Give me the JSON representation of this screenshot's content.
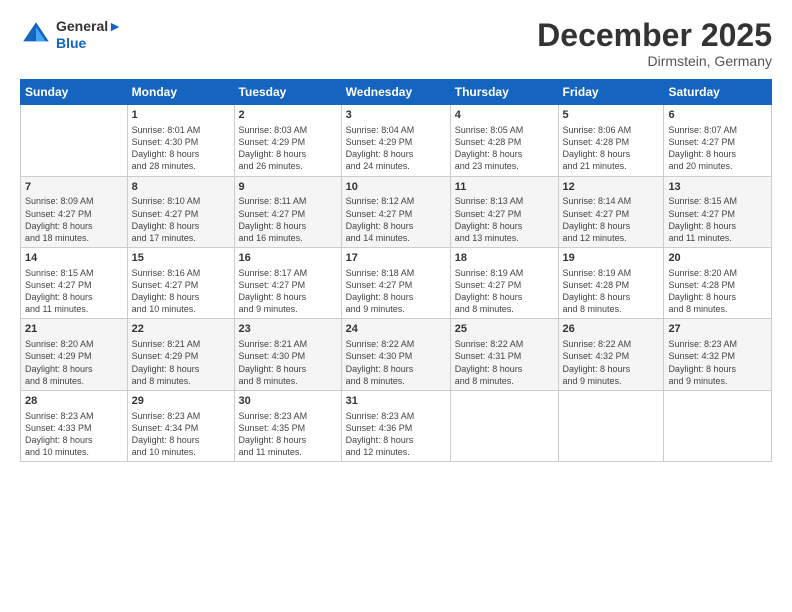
{
  "header": {
    "logo_line1": "General",
    "logo_line2": "Blue",
    "month": "December 2025",
    "location": "Dirmstein, Germany"
  },
  "weekdays": [
    "Sunday",
    "Monday",
    "Tuesday",
    "Wednesday",
    "Thursday",
    "Friday",
    "Saturday"
  ],
  "weeks": [
    [
      {
        "day": "",
        "text": ""
      },
      {
        "day": "1",
        "text": "Sunrise: 8:01 AM\nSunset: 4:30 PM\nDaylight: 8 hours\nand 28 minutes."
      },
      {
        "day": "2",
        "text": "Sunrise: 8:03 AM\nSunset: 4:29 PM\nDaylight: 8 hours\nand 26 minutes."
      },
      {
        "day": "3",
        "text": "Sunrise: 8:04 AM\nSunset: 4:29 PM\nDaylight: 8 hours\nand 24 minutes."
      },
      {
        "day": "4",
        "text": "Sunrise: 8:05 AM\nSunset: 4:28 PM\nDaylight: 8 hours\nand 23 minutes."
      },
      {
        "day": "5",
        "text": "Sunrise: 8:06 AM\nSunset: 4:28 PM\nDaylight: 8 hours\nand 21 minutes."
      },
      {
        "day": "6",
        "text": "Sunrise: 8:07 AM\nSunset: 4:27 PM\nDaylight: 8 hours\nand 20 minutes."
      }
    ],
    [
      {
        "day": "7",
        "text": "Sunrise: 8:09 AM\nSunset: 4:27 PM\nDaylight: 8 hours\nand 18 minutes."
      },
      {
        "day": "8",
        "text": "Sunrise: 8:10 AM\nSunset: 4:27 PM\nDaylight: 8 hours\nand 17 minutes."
      },
      {
        "day": "9",
        "text": "Sunrise: 8:11 AM\nSunset: 4:27 PM\nDaylight: 8 hours\nand 16 minutes."
      },
      {
        "day": "10",
        "text": "Sunrise: 8:12 AM\nSunset: 4:27 PM\nDaylight: 8 hours\nand 14 minutes."
      },
      {
        "day": "11",
        "text": "Sunrise: 8:13 AM\nSunset: 4:27 PM\nDaylight: 8 hours\nand 13 minutes."
      },
      {
        "day": "12",
        "text": "Sunrise: 8:14 AM\nSunset: 4:27 PM\nDaylight: 8 hours\nand 12 minutes."
      },
      {
        "day": "13",
        "text": "Sunrise: 8:15 AM\nSunset: 4:27 PM\nDaylight: 8 hours\nand 11 minutes."
      }
    ],
    [
      {
        "day": "14",
        "text": "Sunrise: 8:15 AM\nSunset: 4:27 PM\nDaylight: 8 hours\nand 11 minutes."
      },
      {
        "day": "15",
        "text": "Sunrise: 8:16 AM\nSunset: 4:27 PM\nDaylight: 8 hours\nand 10 minutes."
      },
      {
        "day": "16",
        "text": "Sunrise: 8:17 AM\nSunset: 4:27 PM\nDaylight: 8 hours\nand 9 minutes."
      },
      {
        "day": "17",
        "text": "Sunrise: 8:18 AM\nSunset: 4:27 PM\nDaylight: 8 hours\nand 9 minutes."
      },
      {
        "day": "18",
        "text": "Sunrise: 8:19 AM\nSunset: 4:27 PM\nDaylight: 8 hours\nand 8 minutes."
      },
      {
        "day": "19",
        "text": "Sunrise: 8:19 AM\nSunset: 4:28 PM\nDaylight: 8 hours\nand 8 minutes."
      },
      {
        "day": "20",
        "text": "Sunrise: 8:20 AM\nSunset: 4:28 PM\nDaylight: 8 hours\nand 8 minutes."
      }
    ],
    [
      {
        "day": "21",
        "text": "Sunrise: 8:20 AM\nSunset: 4:29 PM\nDaylight: 8 hours\nand 8 minutes."
      },
      {
        "day": "22",
        "text": "Sunrise: 8:21 AM\nSunset: 4:29 PM\nDaylight: 8 hours\nand 8 minutes."
      },
      {
        "day": "23",
        "text": "Sunrise: 8:21 AM\nSunset: 4:30 PM\nDaylight: 8 hours\nand 8 minutes."
      },
      {
        "day": "24",
        "text": "Sunrise: 8:22 AM\nSunset: 4:30 PM\nDaylight: 8 hours\nand 8 minutes."
      },
      {
        "day": "25",
        "text": "Sunrise: 8:22 AM\nSunset: 4:31 PM\nDaylight: 8 hours\nand 8 minutes."
      },
      {
        "day": "26",
        "text": "Sunrise: 8:22 AM\nSunset: 4:32 PM\nDaylight: 8 hours\nand 9 minutes."
      },
      {
        "day": "27",
        "text": "Sunrise: 8:23 AM\nSunset: 4:32 PM\nDaylight: 8 hours\nand 9 minutes."
      }
    ],
    [
      {
        "day": "28",
        "text": "Sunrise: 8:23 AM\nSunset: 4:33 PM\nDaylight: 8 hours\nand 10 minutes."
      },
      {
        "day": "29",
        "text": "Sunrise: 8:23 AM\nSunset: 4:34 PM\nDaylight: 8 hours\nand 10 minutes."
      },
      {
        "day": "30",
        "text": "Sunrise: 8:23 AM\nSunset: 4:35 PM\nDaylight: 8 hours\nand 11 minutes."
      },
      {
        "day": "31",
        "text": "Sunrise: 8:23 AM\nSunset: 4:36 PM\nDaylight: 8 hours\nand 12 minutes."
      },
      {
        "day": "",
        "text": ""
      },
      {
        "day": "",
        "text": ""
      },
      {
        "day": "",
        "text": ""
      }
    ]
  ]
}
